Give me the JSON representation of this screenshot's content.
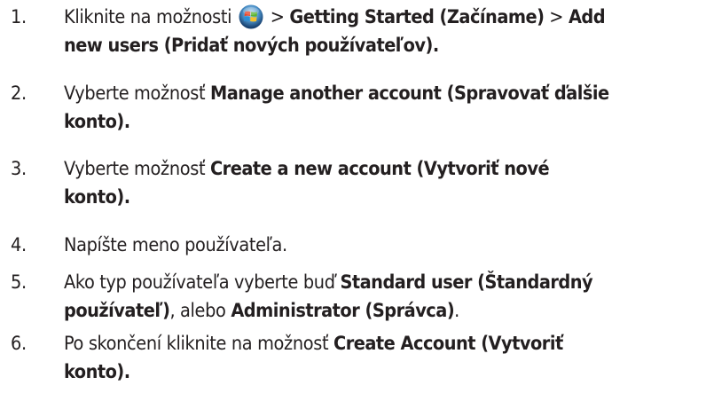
{
  "steps": [
    {
      "num": "1.",
      "pre": "Kliknite na možnosti",
      "sep1": ">",
      "b1": "Getting Started (Začíname)",
      "sep2": ">",
      "b2a": "Add",
      "b2b": "new users (Pridať nových používateľov).",
      "icon": "windows-start-orb-icon"
    },
    {
      "num": "2.",
      "pre": "Vyberte možnosť",
      "b1": "Manage another account (Spravovať ďalšie",
      "b2": "konto)."
    },
    {
      "num": "3.",
      "pre": "Vyberte možnosť",
      "b1": "Create a new account (Vytvoriť nové",
      "b2": "konto)."
    },
    {
      "num": "4.",
      "text": "Napíšte meno používateľa."
    },
    {
      "num": "5.",
      "pre": "Ako typ používateľa vyberte buď",
      "b1": "Standard user (Štandardný",
      "b2": "používateľ)",
      "mid": ", alebo",
      "b3": "Administrator (Správca)",
      "post": "."
    },
    {
      "num": "6.",
      "pre": "Po skončení kliknite na možnosť",
      "b1": "Create Account (Vytvoriť",
      "b2": "konto)."
    }
  ],
  "colors": {
    "text": "#231f20",
    "orb_red": "#e8462a",
    "orb_green": "#5cb531",
    "orb_blue": "#2a8fd8",
    "orb_yellow": "#f6c12d"
  }
}
